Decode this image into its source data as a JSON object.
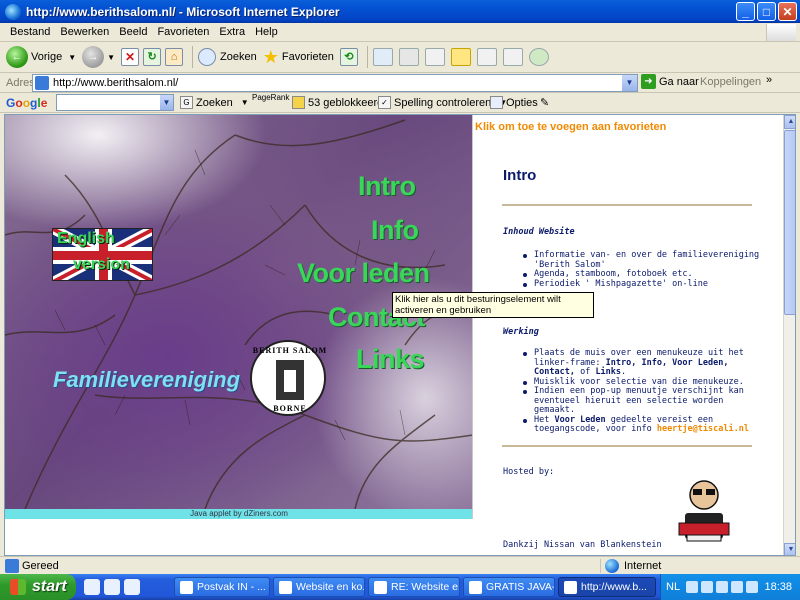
{
  "window": {
    "title": "http://www.berithsalom.nl/ - Microsoft Internet Explorer",
    "minimize": "_",
    "maximize": "□",
    "close": "✕"
  },
  "menu": [
    "Bestand",
    "Bewerken",
    "Beeld",
    "Favorieten",
    "Extra",
    "Help"
  ],
  "toolbar": {
    "back": "Vorige",
    "search": "Zoeken",
    "favorites": "Favorieten"
  },
  "address": {
    "label": "Adres",
    "url": "http://www.berithsalom.nl/",
    "go": "Ga naar",
    "links": "Koppelingen"
  },
  "googlebar": {
    "search": "Zoeken",
    "pagerank": "PageRank",
    "blocked": "53 geblokkeerd",
    "spell": "Spelling controleren",
    "options": "Opties"
  },
  "left_frame": {
    "english_line1": "English",
    "english_line2": "version",
    "menu_links": [
      "Intro",
      "Info",
      "Voor leden",
      "Contact",
      "Links"
    ],
    "familie": "Familievereniging",
    "logo_top": "BERITH SALOM",
    "logo_bottom": "BORNE",
    "applet_credit": "Java applet by dZiners.com"
  },
  "tooltip": "Klik hier als u dit besturingselement wilt activeren en gebruiken",
  "right_frame": {
    "fav_link": "Klik om toe te voegen aan favorieten",
    "title": "Intro",
    "section1_title": "Inhoud Website",
    "section1_items": [
      "Informatie van- en over de familievereniging 'Berith Salom'",
      "Agenda, stamboom, fotoboek etc.",
      "Periodiek ' Mishpagazette' on-line"
    ],
    "section2_title": "Werking",
    "section2_items": [
      {
        "pre": "Plaats de muis over een menukeuze uit het linker-frame: ",
        "bold": "Intro, Info, Voor Leden, Contact,",
        "mid": " of ",
        "bold2": "Links",
        "post": "."
      },
      {
        "pre": "Muisklik voor selectie van die menukeuze.",
        "bold": "",
        "mid": "",
        "bold2": "",
        "post": ""
      },
      {
        "pre": "Indien een pop-up menuutje verschijnt kan eventueel hieruit een selectie worden gemaakt.",
        "bold": "",
        "mid": "",
        "bold2": "",
        "post": ""
      },
      {
        "pre": "Het ",
        "bold": "Voor Leden",
        "mid": " gedeelte vereist een toegangscode, voor info ",
        "bold2": "",
        "post": ""
      }
    ],
    "email": "heertje@tiscali.nl",
    "hosted": "Hosted by:",
    "thanks": "Dankzij Nissan van Blankenstein"
  },
  "status": {
    "text": "Gereed",
    "zone": "Internet"
  },
  "taskbar": {
    "start": "start",
    "tasks": [
      "Postvak IN - ...",
      "Website en ko...",
      "RE: Website e...",
      "GRATIS JAVA-...",
      "http://www.b..."
    ],
    "lang": "NL",
    "clock": "18:38"
  },
  "colors": {
    "menu_green": "#39d65a",
    "accent_orange": "#f08a00",
    "text_navy": "#0b1a6a",
    "tooltip_bg": "#ffffe1"
  }
}
